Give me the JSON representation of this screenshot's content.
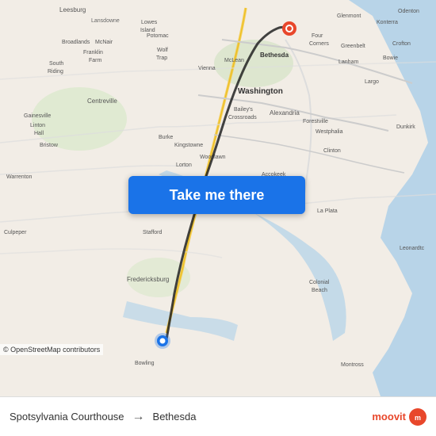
{
  "map": {
    "background_color": "#e8e0d8",
    "attribution": "© OpenStreetMap contributors"
  },
  "button": {
    "label": "Take me there"
  },
  "bottom_bar": {
    "from": "Spotsylvania Courthouse",
    "to": "Bethesda",
    "arrow": "→",
    "moovit": "moovit"
  }
}
